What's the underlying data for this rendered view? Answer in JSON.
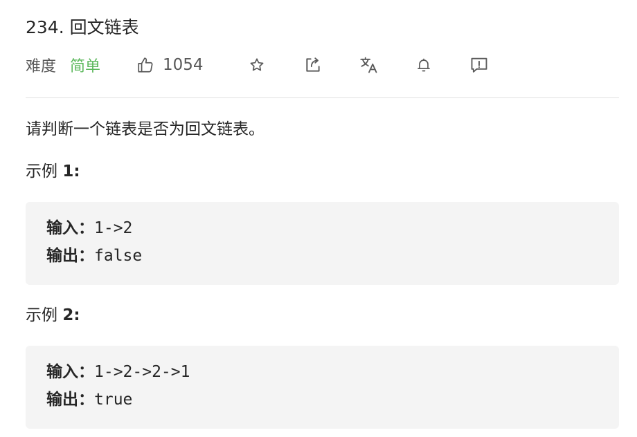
{
  "problem": {
    "title": "234. 回文链表",
    "difficulty_label": "难度",
    "difficulty": "简单",
    "likes": "1054"
  },
  "toolbar": {
    "icons": [
      "thumbs-up-icon",
      "star-icon",
      "share-icon",
      "translate-icon",
      "bell-icon",
      "feedback-icon"
    ]
  },
  "description": "请判断一个链表是否为回文链表。",
  "examples": [
    {
      "title_prefix": "示例 ",
      "title_num": "1:",
      "input_label": "输入：",
      "input": "1->2",
      "output_label": "输出：",
      "output": "false"
    },
    {
      "title_prefix": "示例 ",
      "title_num": "2:",
      "input_label": "输入：",
      "input": "1->2->2->1",
      "output_label": "输出：",
      "output": "true"
    }
  ],
  "colors": {
    "easy": "#5cb85c",
    "code_bg": "#f4f4f4",
    "divider": "#e0e0e0"
  }
}
